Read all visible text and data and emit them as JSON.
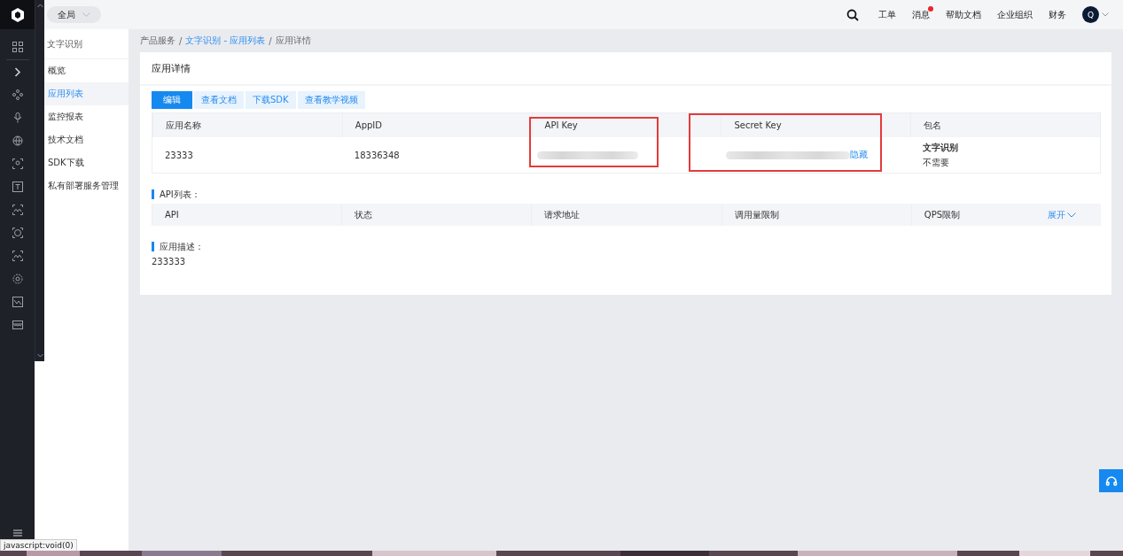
{
  "top_bar": {
    "scope": "全局",
    "nav": [
      {
        "label": "工单",
        "badge": false
      },
      {
        "label": "消息",
        "badge": true
      },
      {
        "label": "帮助文档",
        "badge": false
      },
      {
        "label": "企业组织",
        "badge": false
      },
      {
        "label": "财务",
        "badge": false
      }
    ],
    "avatar": "Q"
  },
  "sidebar": {
    "title": "文字识别",
    "items": [
      {
        "label": "概览",
        "selected": false
      },
      {
        "label": "应用列表",
        "selected": true
      },
      {
        "label": "监控报表",
        "selected": false
      },
      {
        "label": "技术文档",
        "selected": false
      },
      {
        "label": "SDK下载",
        "selected": false
      },
      {
        "label": "私有部署服务管理",
        "selected": false
      }
    ]
  },
  "breadcrumb_separator": "/",
  "breadcrumb": [
    {
      "label": "产品服务",
      "link": false
    },
    {
      "label": "文字识别 - 应用列表",
      "link": true
    },
    {
      "label": "应用详情",
      "link": false
    }
  ],
  "card": {
    "title": "应用详情",
    "actions": [
      {
        "label": "编辑",
        "kind": "primary"
      },
      {
        "label": "查看文档",
        "kind": "plain"
      },
      {
        "label": "下载SDK",
        "kind": "plain"
      },
      {
        "label": "查看教学视频",
        "kind": "plain"
      }
    ],
    "app_table": {
      "columns": [
        {
          "label": "应用名称",
          "highlighted": false
        },
        {
          "label": "AppID",
          "highlighted": false
        },
        {
          "label": "API Key",
          "highlighted": true
        },
        {
          "label": "Secret Key",
          "highlighted": true
        },
        {
          "label": "包名",
          "highlighted": false
        }
      ],
      "row": [
        {
          "kind": "text",
          "text": "23333"
        },
        {
          "kind": "text",
          "text": "18336348"
        },
        {
          "kind": "masked"
        },
        {
          "kind": "masked",
          "toggle": "隐藏"
        },
        {
          "kind": "stacked",
          "title": "文字识别",
          "text": "不需要"
        }
      ]
    },
    "api_list": {
      "title": "API列表：",
      "columns": [
        "API",
        "状态",
        "请求地址",
        "调用量限制",
        "QPS限制"
      ],
      "expand": "展开"
    },
    "description": {
      "title": "应用描述：",
      "text": "233333"
    }
  },
  "status_tooltip": "javascript:void(0)"
}
